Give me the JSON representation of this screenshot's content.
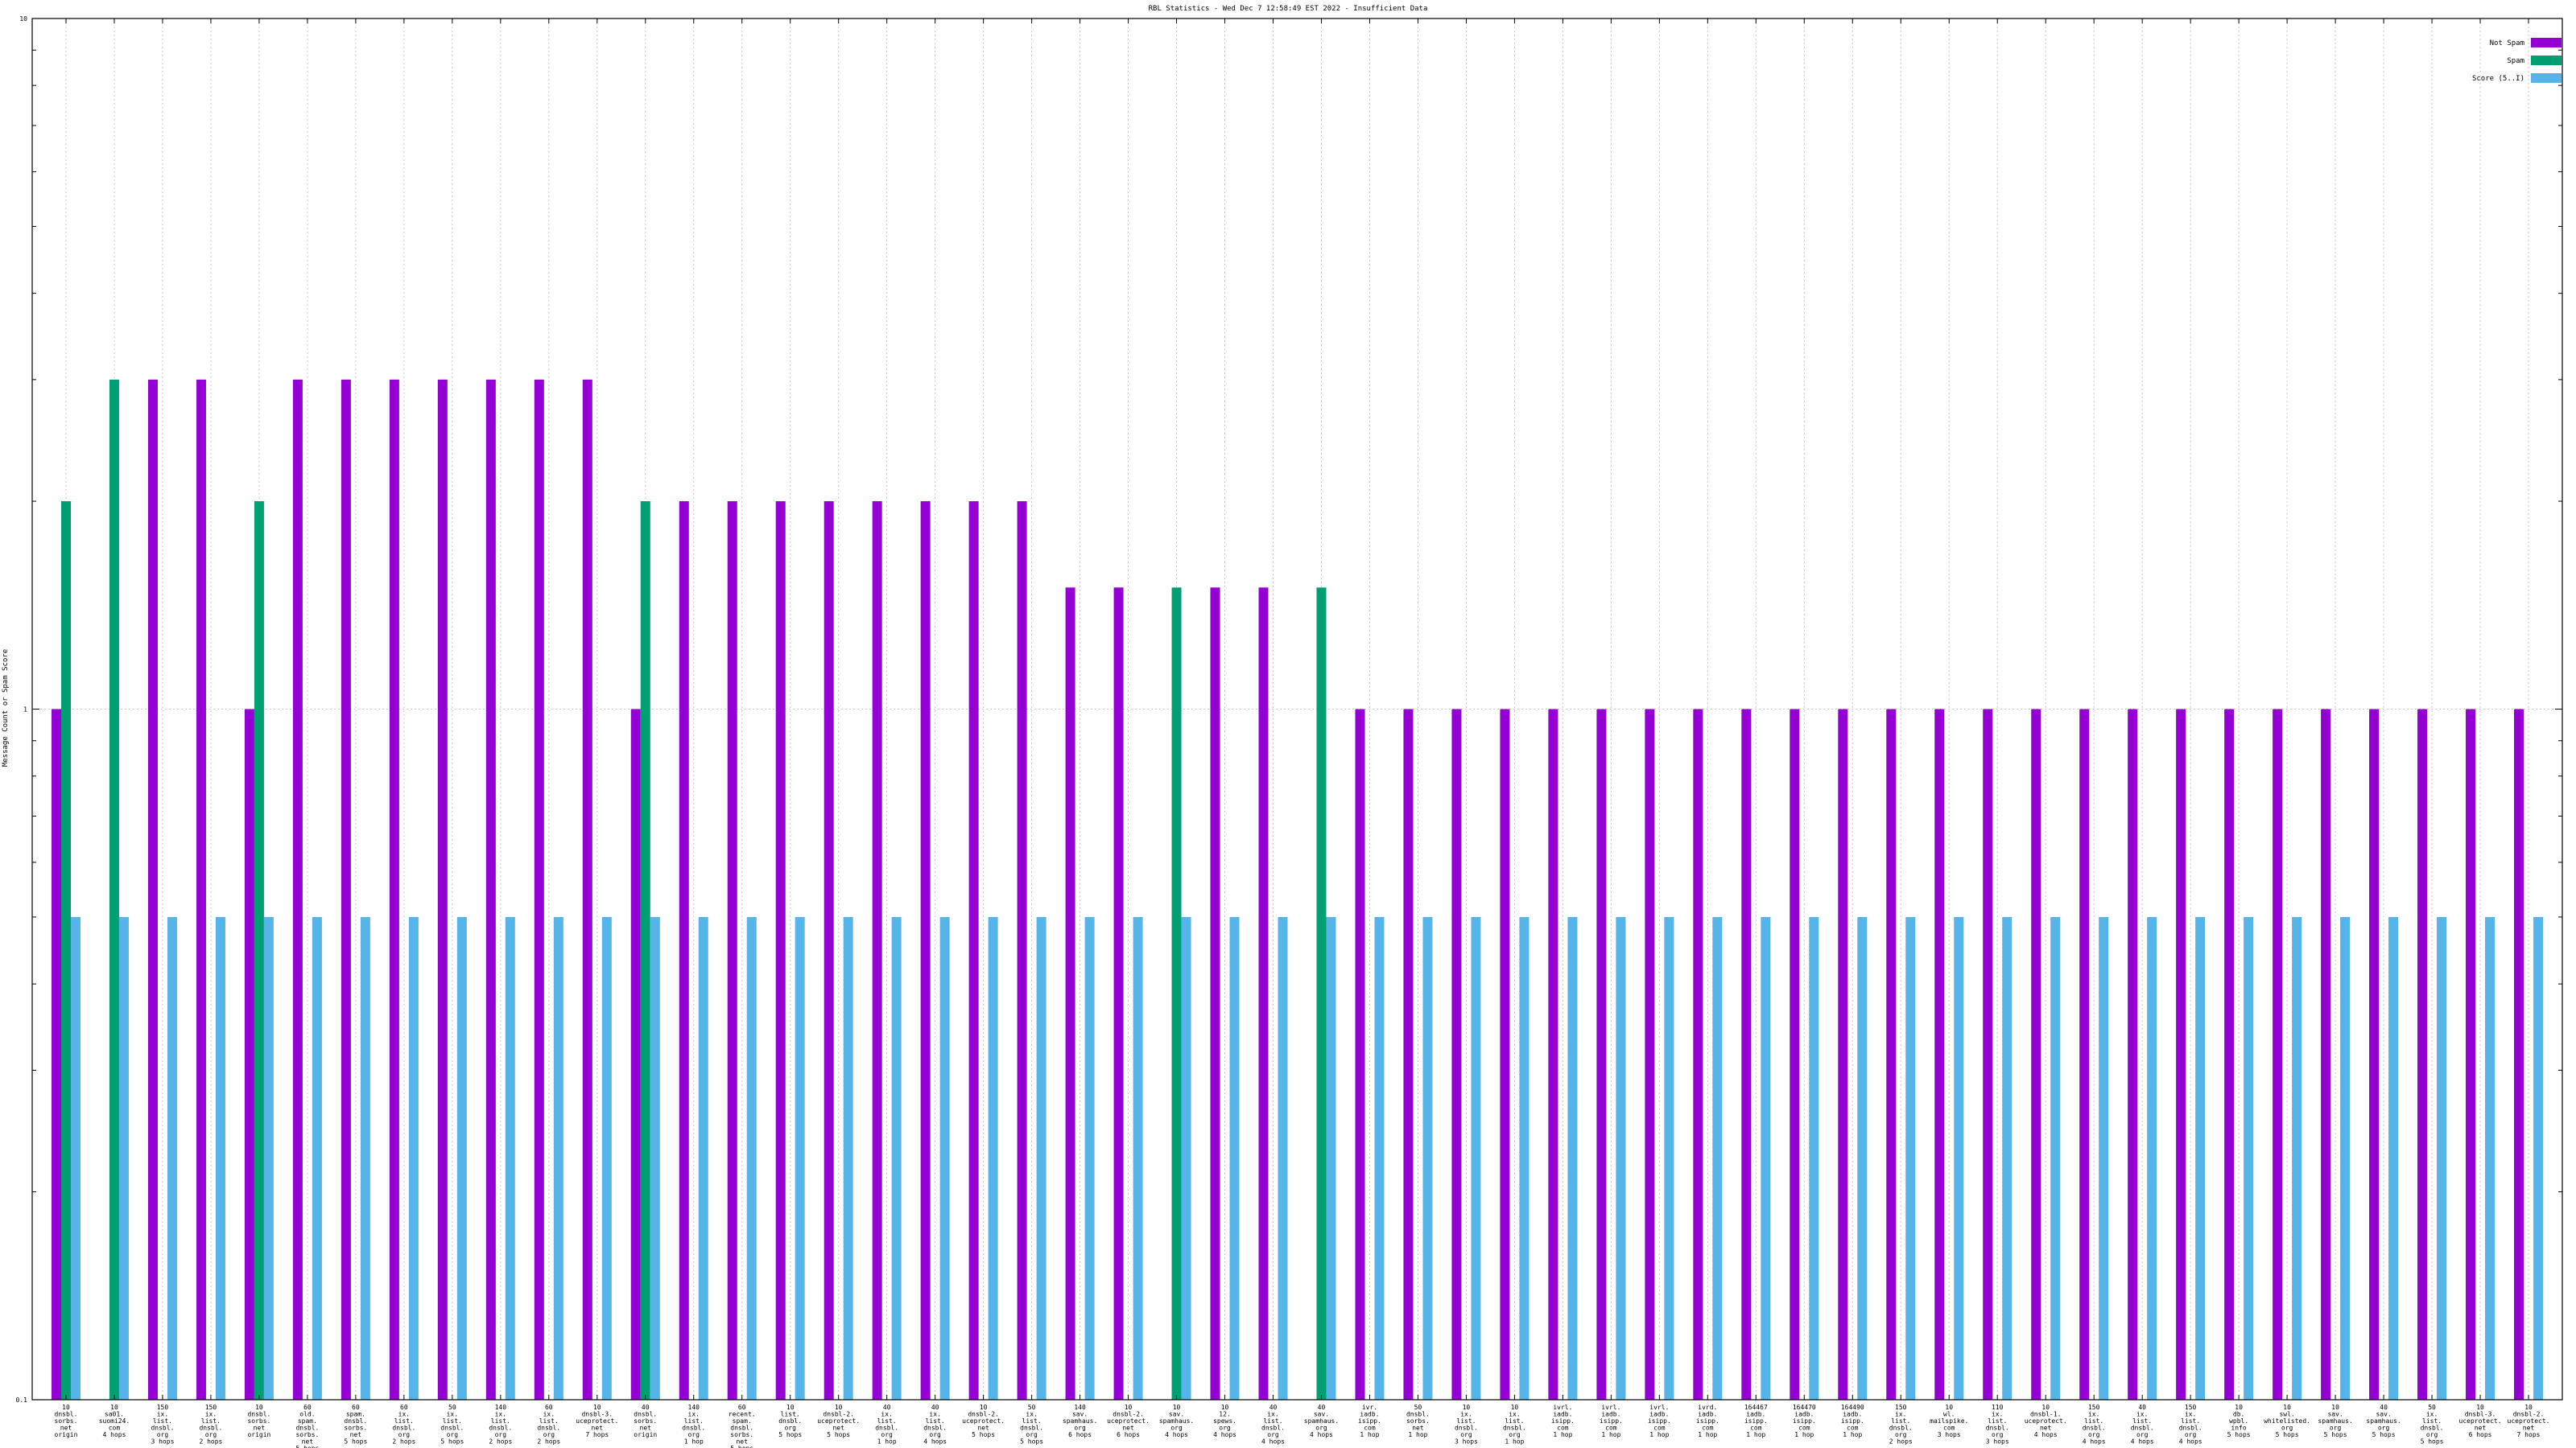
{
  "chart_data": {
    "type": "bar",
    "title": "RBL Statistics - Wed Dec  7 12:58:49 EST 2022 - Insufficient Data",
    "xlabel": "",
    "ylabel": "Message Count or Spam Score",
    "yscale": "log",
    "ylim": [
      0.1,
      10
    ],
    "ytick_labels": [
      "0.1",
      "1",
      "10"
    ],
    "grid": true,
    "legend_position": "top-right",
    "categories": [
      [
        "10",
        "dnsbl.",
        "sorbs.",
        "net",
        "origin"
      ],
      [
        "10",
        "sa01.",
        "suomi24.",
        "com",
        "4 hops"
      ],
      [
        "150",
        "ix.",
        "list.",
        "dnsbl.",
        "org",
        "3 hops"
      ],
      [
        "150",
        "ix.",
        "list.",
        "dnsbl.",
        "org",
        "2 hops"
      ],
      [
        "10",
        "dnsbl.",
        "sorbs.",
        "net",
        "origin"
      ],
      [
        "60",
        "old.",
        "spam.",
        "dnsbl.",
        "sorbs.",
        "net",
        "5 hops"
      ],
      [
        "60",
        "spam.",
        "dnsbl.",
        "sorbs.",
        "net",
        "5 hops"
      ],
      [
        "60",
        "ix.",
        "list.",
        "dnsbl.",
        "org",
        "2 hops"
      ],
      [
        "50",
        "ix.",
        "list.",
        "dnsbl.",
        "org",
        "5 hops"
      ],
      [
        "140",
        "ix.",
        "list.",
        "dnsbl.",
        "org",
        "2 hops"
      ],
      [
        "60",
        "ix.",
        "list.",
        "dnsbl.",
        "org",
        "2 hops"
      ],
      [
        "10",
        "dnsbl-3.",
        "uceprotect.",
        "net",
        "7 hops"
      ],
      [
        "40",
        "dnsbl.",
        "sorbs.",
        "net",
        "origin"
      ],
      [
        "140",
        "ix.",
        "list.",
        "dnsbl.",
        "org",
        "1 hop"
      ],
      [
        "60",
        "recent.",
        "spam.",
        "dnsbl.",
        "sorbs.",
        "net",
        "5 hops"
      ],
      [
        "10",
        "list.",
        "dnsbl.",
        "org",
        "5 hops"
      ],
      [
        "10",
        "dnsbl-2.",
        "uceprotect.",
        "net",
        "5 hops"
      ],
      [
        "40",
        "ix.",
        "list.",
        "dnsbl.",
        "org",
        "1 hop"
      ],
      [
        "40",
        "ix.",
        "list.",
        "dnsbl.",
        "org",
        "4 hops"
      ],
      [
        "10",
        "dnsbl-2.",
        "uceprotect.",
        "net",
        "5 hops"
      ],
      [
        "50",
        "ix.",
        "list.",
        "dnsbl.",
        "org",
        "5 hops"
      ],
      [
        "140",
        "sav.",
        "spamhaus.",
        "org",
        "6 hops"
      ],
      [
        "10",
        "dnsbl-2.",
        "uceprotect.",
        "net",
        "6 hops"
      ],
      [
        "10",
        "sav.",
        "spamhaus.",
        "org",
        "4 hops"
      ],
      [
        "10",
        "12.",
        "spews.",
        "org",
        "4 hops"
      ],
      [
        "40",
        "ix.",
        "list.",
        "dnsbl.",
        "org",
        "4 hops"
      ],
      [
        "40",
        "sav.",
        "spamhaus.",
        "org",
        "4 hops"
      ],
      [
        "ivr.",
        "iadb.",
        "isipp.",
        "com",
        "1 hop"
      ],
      [
        "50",
        "dnsbl.",
        "sorbs.",
        "net",
        "1 hop"
      ],
      [
        "10",
        "ix.",
        "list.",
        "dnsbl.",
        "org",
        "3 hops"
      ],
      [
        "10",
        "ix.",
        "list.",
        "dnsbl.",
        "org",
        "1 hop"
      ],
      [
        "ivrl.",
        "iadb.",
        "isipp.",
        "com",
        "1 hop"
      ],
      [
        "ivrl.",
        "iadb.",
        "isipp.",
        "com",
        "1 hop"
      ],
      [
        "ivrl.",
        "iadb.",
        "isipp.",
        "com",
        "1 hop"
      ],
      [
        "ivrd.",
        "iadb.",
        "isipp.",
        "com",
        "1 hop"
      ],
      [
        "164467",
        "iadb.",
        "isipp.",
        "com",
        "1 hop"
      ],
      [
        "164470",
        "iadb.",
        "isipp.",
        "com",
        "1 hop"
      ],
      [
        "164490",
        "iadb.",
        "isipp.",
        "com",
        "1 hop"
      ],
      [
        "150",
        "ix.",
        "list.",
        "dnsbl.",
        "org",
        "2 hops"
      ],
      [
        "10",
        "wl.",
        "mailspike.",
        "com",
        "3 hops"
      ],
      [
        "110",
        "ix.",
        "list.",
        "dnsbl.",
        "org",
        "3 hops"
      ],
      [
        "10",
        "dnsbl-1.",
        "uceprotect.",
        "net",
        "4 hops"
      ],
      [
        "150",
        "ix.",
        "list.",
        "dnsbl.",
        "org",
        "4 hops"
      ],
      [
        "40",
        "ix.",
        "list.",
        "dnsbl.",
        "org",
        "4 hops"
      ],
      [
        "150",
        "ix.",
        "list.",
        "dnsbl.",
        "org",
        "4 hops"
      ],
      [
        "10",
        "db.",
        "wpbl.",
        "info",
        "5 hops"
      ],
      [
        "10",
        "swl.",
        "whitelisted.",
        "org",
        "5 hops"
      ],
      [
        "10",
        "sav.",
        "spamhaus.",
        "org",
        "5 hops"
      ],
      [
        "40",
        "sav.",
        "spamhaus.",
        "org",
        "5 hops"
      ],
      [
        "50",
        "ix.",
        "list.",
        "dnsbl.",
        "org",
        "5 hops"
      ],
      [
        "10",
        "dnsbl-3.",
        "uceprotect.",
        "net",
        "6 hops"
      ],
      [
        "10",
        "dnsbl-2.",
        "uceprotect.",
        "net",
        "7 hops"
      ]
    ],
    "series": [
      {
        "name": "Not Spam",
        "color": "#9400d3",
        "values": [
          1,
          null,
          3,
          3,
          1,
          3,
          3,
          3,
          3,
          3,
          3,
          3,
          1,
          2,
          2,
          2,
          2,
          2,
          2,
          2,
          2,
          1.5,
          1.5,
          null,
          1.5,
          1.5,
          null,
          1,
          1,
          1,
          1,
          1,
          1,
          1,
          1,
          1,
          1,
          1,
          1,
          1,
          1,
          1,
          1,
          1,
          1,
          1,
          1,
          1,
          1,
          1,
          1,
          1
        ]
      },
      {
        "name": "Spam",
        "color": "#009e73",
        "values": [
          2,
          3,
          null,
          null,
          2,
          null,
          null,
          null,
          null,
          null,
          null,
          null,
          2,
          null,
          null,
          null,
          null,
          null,
          null,
          null,
          null,
          null,
          null,
          1.5,
          null,
          null,
          1.5,
          null,
          null,
          null,
          null,
          null,
          null,
          null,
          null,
          null,
          null,
          null,
          null,
          null,
          null,
          null,
          null,
          null,
          null,
          null,
          null,
          null,
          null,
          null,
          null,
          null
        ]
      },
      {
        "name": "Score (5..I)",
        "color": "#56b4e9",
        "values": [
          0.5,
          0.5,
          0.5,
          0.5,
          0.5,
          0.5,
          0.5,
          0.5,
          0.5,
          0.5,
          0.5,
          0.5,
          0.5,
          0.5,
          0.5,
          0.5,
          0.5,
          0.5,
          0.5,
          0.5,
          0.5,
          0.5,
          0.5,
          0.5,
          0.5,
          0.5,
          0.5,
          0.5,
          0.5,
          0.5,
          0.5,
          0.5,
          0.5,
          0.5,
          0.5,
          0.5,
          0.5,
          0.5,
          0.5,
          0.5,
          0.5,
          0.5,
          0.5,
          0.5,
          0.5,
          0.5,
          0.5,
          0.5,
          0.5,
          0.5,
          0.5,
          0.5
        ]
      }
    ]
  }
}
